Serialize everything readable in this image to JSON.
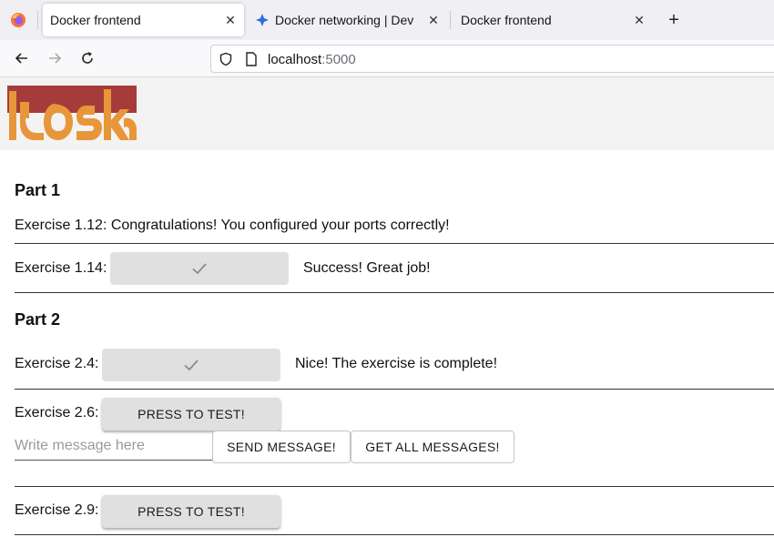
{
  "browser": {
    "tabs": [
      {
        "title": "Docker frontend",
        "active": true
      },
      {
        "title": "Docker networking | Dev",
        "active": false
      },
      {
        "title": "Docker frontend",
        "active": false
      }
    ],
    "url": {
      "host": "localhost",
      "port": ":5000"
    }
  },
  "page": {
    "part1": {
      "heading": "Part 1",
      "ex112": "Exercise 1.12: Congratulations! You configured your ports correctly!",
      "ex114": {
        "label": "Exercise 1.14:",
        "status": "Success! Great job!"
      }
    },
    "part2": {
      "heading": "Part 2",
      "ex24": {
        "label": "Exercise 2.4:",
        "status": "Nice! The exercise is complete!"
      },
      "ex26": {
        "label": "Exercise 2.6:",
        "test_button": "PRESS TO TEST!",
        "message_placeholder": "Write message here",
        "message_value": "",
        "send_button": "SEND MESSAGE!",
        "get_all_button": "GET ALL MESSAGES!"
      },
      "ex29": {
        "label": "Exercise 2.9:",
        "test_button": "PRESS TO TEST!"
      }
    }
  },
  "colors": {
    "logo_red": "#a63c3a",
    "logo_orange": "#e8963a",
    "done_button": "#e0e0e0"
  }
}
